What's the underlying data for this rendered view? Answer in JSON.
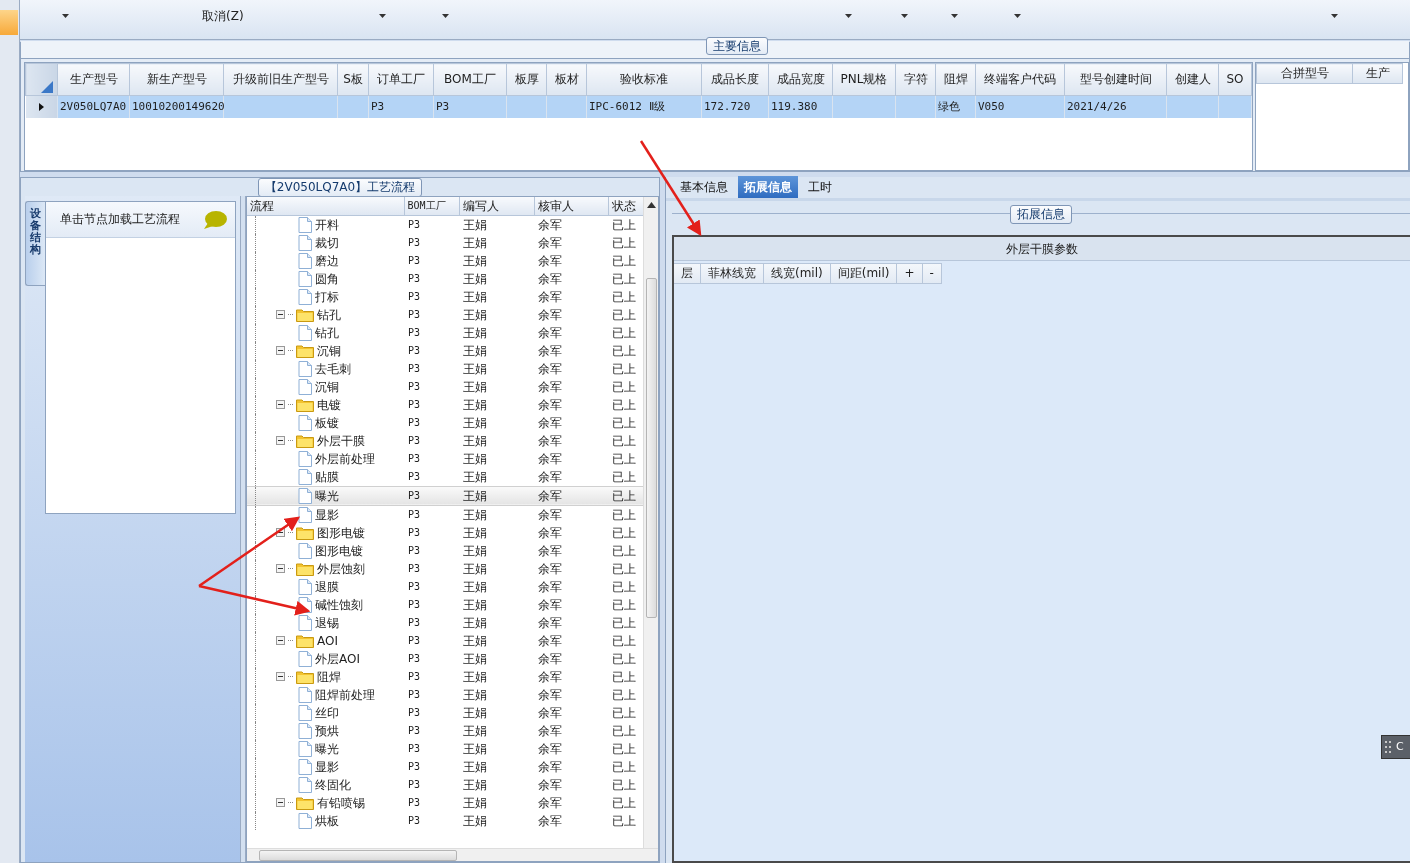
{
  "ribbon": {
    "items": [
      {
        "kind": "caret"
      },
      {
        "kind": "label",
        "text": "取消(Z)"
      },
      {
        "kind": "caret"
      },
      {
        "kind": "caret"
      },
      {
        "kind": "caret"
      },
      {
        "kind": "caret"
      },
      {
        "kind": "caret"
      },
      {
        "kind": "caret"
      },
      {
        "kind": "caret"
      }
    ]
  },
  "main_info": {
    "title": "主要信息",
    "grid": {
      "columns": [
        "生产型号",
        "新生产型号",
        "升级前旧生产型号",
        "S板",
        "订单工厂",
        "BOM工厂",
        "板厚",
        "板材",
        "验收标准",
        "成品长度",
        "成品宽度",
        "PNL规格",
        "字符",
        "阻焊",
        "终端客户代码",
        "型号创建时间",
        "创建人",
        "SO"
      ],
      "rows": [
        {
          "selected": true,
          "cells": [
            "2V050LQ7A0",
            "10010200149620",
            null,
            null,
            "P3",
            "P3",
            null,
            null,
            "IPC-6012 Ⅱ级",
            "172.720",
            "119.380",
            null,
            null,
            "绿色",
            "V050",
            "2021/4/26",
            null,
            null
          ]
        }
      ]
    },
    "merge_grid": {
      "columns": [
        "合拼型号",
        "生产"
      ]
    }
  },
  "process": {
    "title": "【2V050LQ7A0】工艺流程",
    "side_tab": "设备结构",
    "hint": "单击节点加载工艺流程",
    "tree": {
      "columns": [
        "流程",
        "BOM工厂",
        "编写人",
        "核审人",
        "状态"
      ],
      "nodes": [
        {
          "kind": "file",
          "label": "开料",
          "bom": "P3",
          "author": "王娟",
          "reviewer": "余军",
          "status": "已上",
          "selected": false
        },
        {
          "kind": "file",
          "label": "裁切",
          "bom": "P3",
          "author": "王娟",
          "reviewer": "余军",
          "status": "已上",
          "selected": false
        },
        {
          "kind": "file",
          "label": "磨边",
          "bom": "P3",
          "author": "王娟",
          "reviewer": "余军",
          "status": "已上",
          "selected": false
        },
        {
          "kind": "file",
          "label": "圆角",
          "bom": "P3",
          "author": "王娟",
          "reviewer": "余军",
          "status": "已上",
          "selected": false
        },
        {
          "kind": "file",
          "label": "打标",
          "bom": "P3",
          "author": "王娟",
          "reviewer": "余军",
          "status": "已上",
          "selected": false
        },
        {
          "kind": "folder",
          "label": "钻孔",
          "bom": "P3",
          "author": "王娟",
          "reviewer": "余军",
          "status": "已上",
          "selected": false,
          "expanded": true,
          "children": [
            {
              "kind": "file",
              "label": "钻孔",
              "bom": "P3",
              "author": "王娟",
              "reviewer": "余军",
              "status": "已上",
              "selected": false
            }
          ]
        },
        {
          "kind": "folder",
          "label": "沉铜",
          "bom": "P3",
          "author": "王娟",
          "reviewer": "余军",
          "status": "已上",
          "selected": false,
          "expanded": true,
          "children": [
            {
              "kind": "file",
              "label": "去毛刺",
              "bom": "P3",
              "author": "王娟",
              "reviewer": "余军",
              "status": "已上",
              "selected": false
            },
            {
              "kind": "file",
              "label": "沉铜",
              "bom": "P3",
              "author": "王娟",
              "reviewer": "余军",
              "status": "已上",
              "selected": false
            }
          ]
        },
        {
          "kind": "folder",
          "label": "电镀",
          "bom": "P3",
          "author": "王娟",
          "reviewer": "余军",
          "status": "已上",
          "selected": false,
          "expanded": true,
          "children": [
            {
              "kind": "file",
              "label": "板镀",
              "bom": "P3",
              "author": "王娟",
              "reviewer": "余军",
              "status": "已上",
              "selected": false
            }
          ]
        },
        {
          "kind": "folder",
          "label": "外层干膜",
          "bom": "P3",
          "author": "王娟",
          "reviewer": "余军",
          "status": "已上",
          "selected": false,
          "expanded": true,
          "children": [
            {
              "kind": "file",
              "label": "外层前处理",
              "bom": "P3",
              "author": "王娟",
              "reviewer": "余军",
              "status": "已上",
              "selected": false
            },
            {
              "kind": "file",
              "label": "贴膜",
              "bom": "P3",
              "author": "王娟",
              "reviewer": "余军",
              "status": "已上",
              "selected": false
            },
            {
              "kind": "file",
              "label": "曝光",
              "bom": "P3",
              "author": "王娟",
              "reviewer": "余军",
              "status": "已上",
              "selected": true
            },
            {
              "kind": "file",
              "label": "显影",
              "bom": "P3",
              "author": "王娟",
              "reviewer": "余军",
              "status": "已上",
              "selected": false
            }
          ]
        },
        {
          "kind": "folder",
          "label": "图形电镀",
          "bom": "P3",
          "author": "王娟",
          "reviewer": "余军",
          "status": "已上",
          "selected": false,
          "expanded": true,
          "children": [
            {
              "kind": "file",
              "label": "图形电镀",
              "bom": "P3",
              "author": "王娟",
              "reviewer": "余军",
              "status": "已上",
              "selected": false
            }
          ]
        },
        {
          "kind": "folder",
          "label": "外层蚀刻",
          "bom": "P3",
          "author": "王娟",
          "reviewer": "余军",
          "status": "已上",
          "selected": false,
          "expanded": true,
          "children": [
            {
              "kind": "file",
              "label": "退膜",
              "bom": "P3",
              "author": "王娟",
              "reviewer": "余军",
              "status": "已上",
              "selected": false
            },
            {
              "kind": "file",
              "label": "碱性蚀刻",
              "bom": "P3",
              "author": "王娟",
              "reviewer": "余军",
              "status": "已上",
              "selected": false
            },
            {
              "kind": "file",
              "label": "退锡",
              "bom": "P3",
              "author": "王娟",
              "reviewer": "余军",
              "status": "已上",
              "selected": false
            }
          ]
        },
        {
          "kind": "folder",
          "label": "AOI",
          "bom": "P3",
          "author": "王娟",
          "reviewer": "余军",
          "status": "已上",
          "selected": false,
          "expanded": true,
          "children": [
            {
              "kind": "file",
              "label": "外层AOI",
              "bom": "P3",
              "author": "王娟",
              "reviewer": "余军",
              "status": "已上",
              "selected": false
            }
          ]
        },
        {
          "kind": "folder",
          "label": "阻焊",
          "bom": "P3",
          "author": "王娟",
          "reviewer": "余军",
          "status": "已上",
          "selected": false,
          "expanded": true,
          "children": [
            {
              "kind": "file",
              "label": "阻焊前处理",
              "bom": "P3",
              "author": "王娟",
              "reviewer": "余军",
              "status": "已上",
              "selected": false
            },
            {
              "kind": "file",
              "label": "丝印",
              "bom": "P3",
              "author": "王娟",
              "reviewer": "余军",
              "status": "已上",
              "selected": false
            },
            {
              "kind": "file",
              "label": "预烘",
              "bom": "P3",
              "author": "王娟",
              "reviewer": "余军",
              "status": "已上",
              "selected": false
            },
            {
              "kind": "file",
              "label": "曝光",
              "bom": "P3",
              "author": "王娟",
              "reviewer": "余军",
              "status": "已上",
              "selected": false
            },
            {
              "kind": "file",
              "label": "显影",
              "bom": "P3",
              "author": "王娟",
              "reviewer": "余军",
              "status": "已上",
              "selected": false
            },
            {
              "kind": "file",
              "label": "终固化",
              "bom": "P3",
              "author": "王娟",
              "reviewer": "余军",
              "status": "已上",
              "selected": false
            }
          ]
        },
        {
          "kind": "folder",
          "label": "有铅喷锡",
          "bom": "P3",
          "author": "王娟",
          "reviewer": "余军",
          "status": "已上",
          "selected": false,
          "expanded": true,
          "children": [
            {
              "kind": "file",
              "label": "烘板",
              "bom": "P3",
              "author": "王娟",
              "reviewer": "余军",
              "status": "已上",
              "selected": false
            }
          ]
        }
      ]
    }
  },
  "detail": {
    "tabs": [
      {
        "label": "基本信息",
        "selected": false
      },
      {
        "label": "拓展信息",
        "selected": true
      },
      {
        "label": "工时",
        "selected": false
      }
    ],
    "section_title": "拓展信息",
    "table_title": "外层干膜参数",
    "columns": [
      "层",
      "菲林线宽",
      "线宽(mil)",
      "间距(mil)",
      "+",
      "-"
    ],
    "floating_button": {
      "label": "C"
    }
  }
}
